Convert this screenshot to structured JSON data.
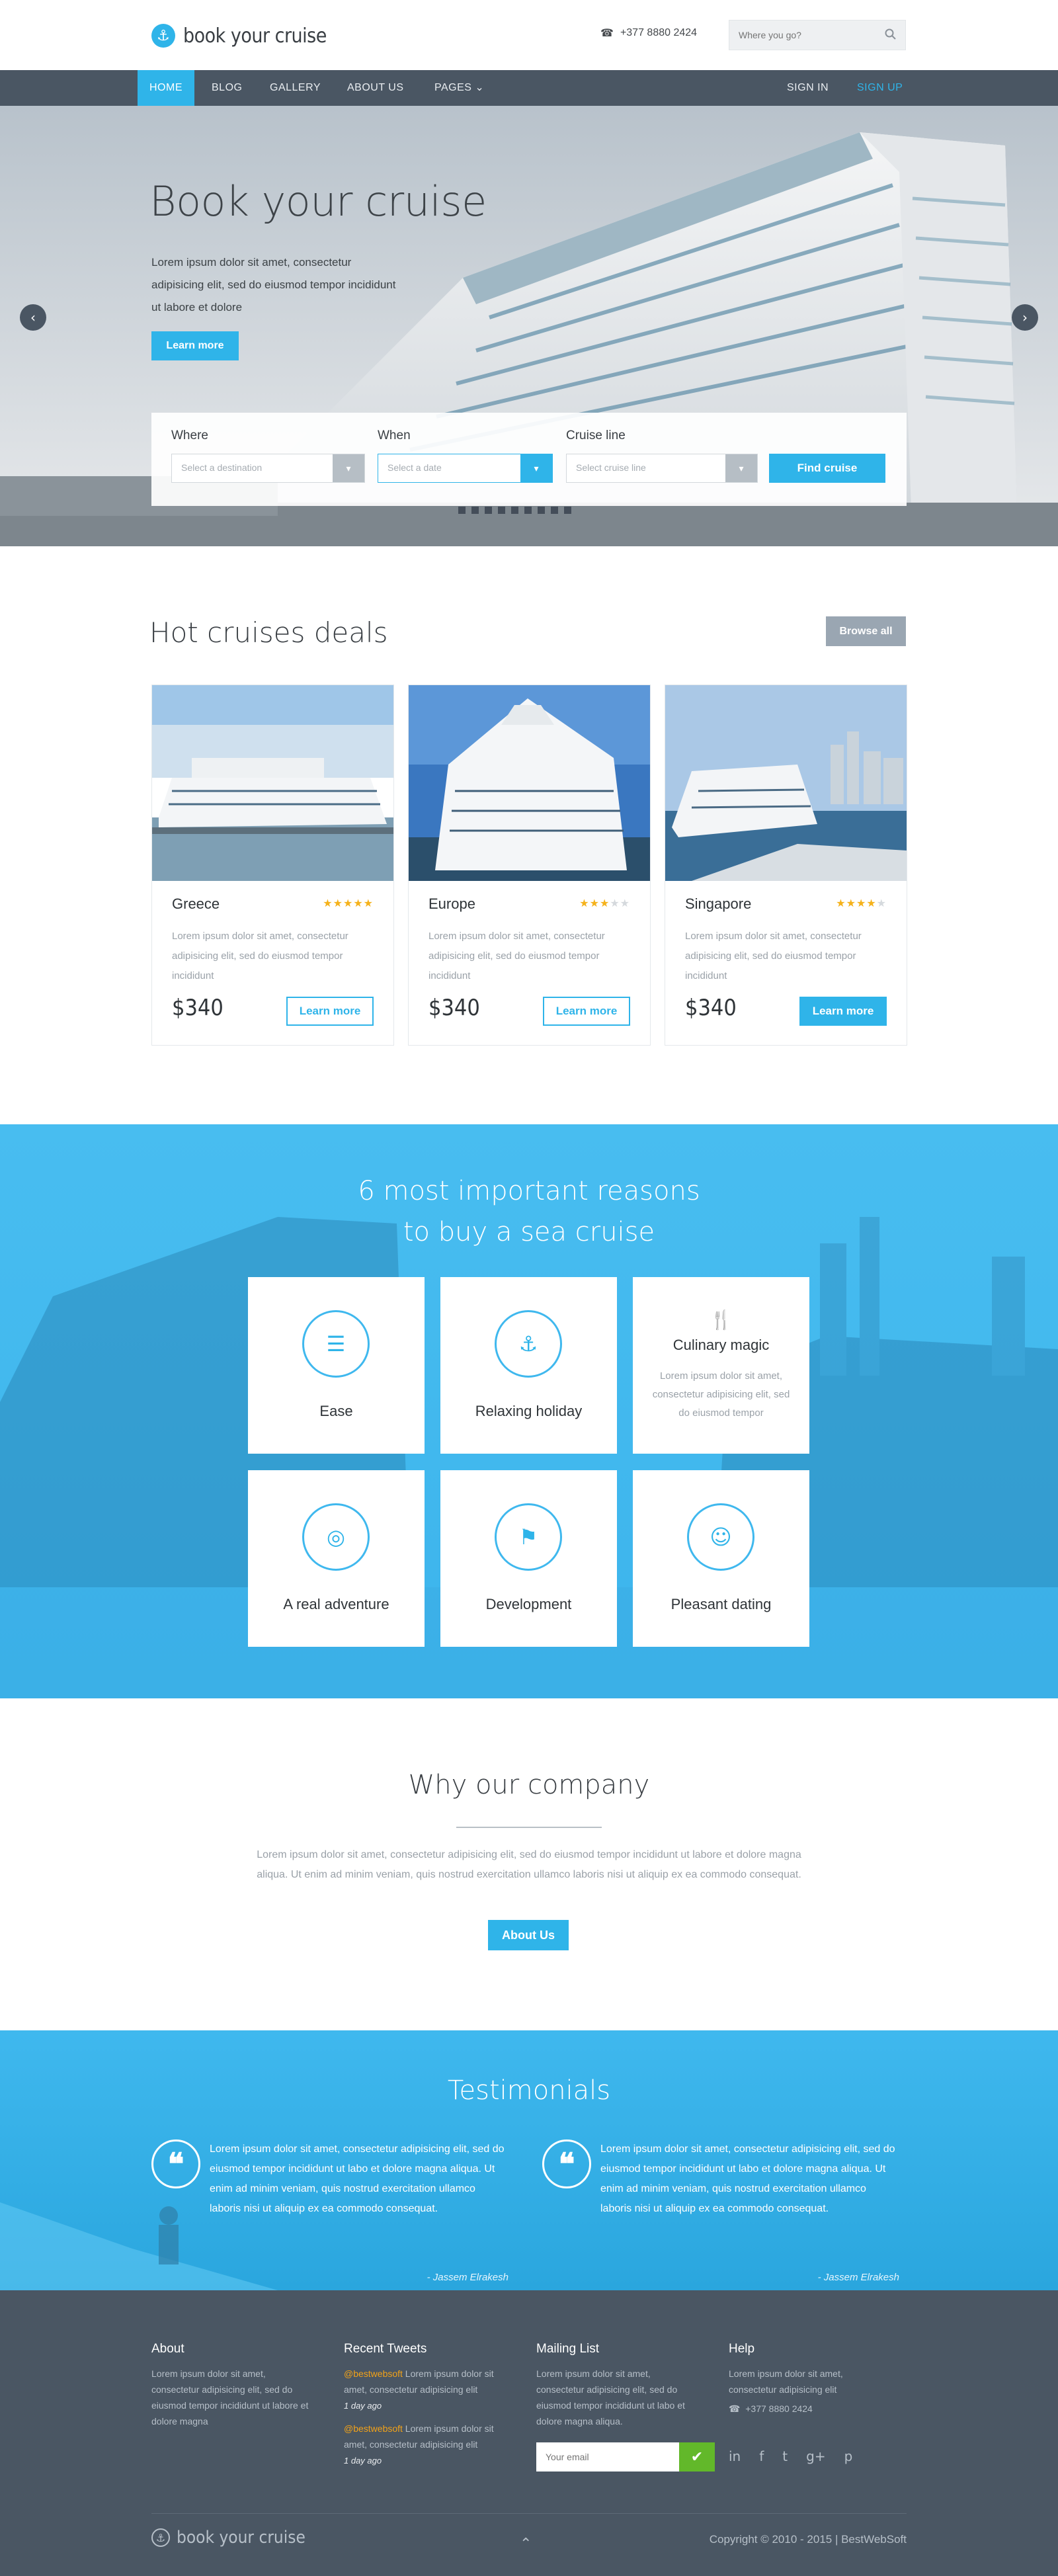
{
  "brand": {
    "name": "book your cruise",
    "icon": "anchor-icon",
    "accent": "#2fb4e9",
    "nav_bg": "#4a5663"
  },
  "header": {
    "phone": "+377  8880  2424",
    "search_placeholder": "Where you go?"
  },
  "nav": {
    "items": [
      "Home",
      "Blog",
      "Gallery",
      "About us",
      "Pages ⌄"
    ],
    "signin": "Sign in",
    "signup": "Sign up"
  },
  "hero": {
    "title": "Book your cruise",
    "lead": "Lorem ipsum dolor sit amet, consectetur adipisicing elit, sed do eiusmod tempor incididunt ut labore et dolore",
    "learn": "Learn more",
    "form": {
      "where_label": "Where",
      "where_placeholder": "Select a destination",
      "when_label": "When",
      "when_placeholder": "Select a date",
      "line_label": "Cruise line",
      "line_placeholder": "Select cruise line",
      "find": "Find cruise"
    },
    "slides": 9
  },
  "deals": {
    "title": "Hot cruises deals",
    "browse": "Browse all",
    "cards": [
      {
        "name": "Greece",
        "rating": 5,
        "desc": "Lorem ipsum dolor sit amet, consectetur adipisicing elit, sed do eiusmod tempor incididunt",
        "price": "$340",
        "button": "Learn more"
      },
      {
        "name": "Europe",
        "rating": 3,
        "desc": "Lorem ipsum dolor sit amet, consectetur adipisicing elit, sed do eiusmod tempor incididunt",
        "price": "$340",
        "button": "Learn more"
      },
      {
        "name": "Singapore",
        "rating": 4,
        "desc": "Lorem ipsum dolor sit amet, consectetur adipisicing elit, sed do eiusmod tempor incididunt",
        "price": "$340",
        "button": "Learn more"
      }
    ]
  },
  "reasons": {
    "title_line1": "6 most important reasons",
    "title_line2": "to buy a sea cruise",
    "items": [
      {
        "title": "Ease",
        "icon": "list-icon"
      },
      {
        "title": "Relaxing holiday",
        "icon": "anchor-icon"
      },
      {
        "title": "Culinary magic",
        "icon": "cutlery-icon",
        "desc": "Lorem ipsum dolor sit amet, consectetur adipisicing elit, sed do eiusmod tempor"
      },
      {
        "title": "A real adventure",
        "icon": "lifebuoy-icon"
      },
      {
        "title": "Development",
        "icon": "flag-icon"
      },
      {
        "title": "Pleasant dating",
        "icon": "smile-icon"
      }
    ]
  },
  "why": {
    "title": "Why our company",
    "text": "Lorem ipsum dolor sit amet, consectetur adipisicing elit, sed do eiusmod tempor incididunt ut labore et dolore magna aliqua. Ut enim ad minim veniam, quis nostrud exercitation ullamco laboris nisi ut aliquip ex ea commodo consequat.",
    "button": "About Us"
  },
  "testimonials": {
    "title": "Testimonials",
    "items": [
      {
        "text": "Lorem ipsum dolor sit amet, consectetur adipisicing elit, sed do eiusmod tempor incididunt ut labo et dolore magna aliqua. Ut enim ad minim veniam, quis nostrud exercitation ullamco laboris nisi ut aliquip ex ea commodo consequat.",
        "author": "- Jassem Elrakesh"
      },
      {
        "text": "Lorem ipsum dolor sit amet, consectetur adipisicing elit, sed do eiusmod tempor incididunt ut labo et dolore magna aliqua. Ut enim ad minim veniam, quis nostrud exercitation ullamco laboris nisi ut aliquip ex ea commodo consequat.",
        "author": "- Jassem Elrakesh"
      }
    ]
  },
  "footer": {
    "about_title": "About",
    "about_text": "Lorem ipsum dolor sit amet, consectetur adipisicing elit, sed do eiusmod tempor incididunt ut labore et dolore magna",
    "tweets_title": "Recent Tweets",
    "tweets": [
      {
        "handle": "@bestwebsoft",
        "text": " Lorem ipsum dolor sit amet, consectetur adipisicing elit",
        "ago": "1 day ago"
      },
      {
        "handle": "@bestwebsoft",
        "text": " Lorem ipsum dolor sit amet, consectetur adipisicing elit",
        "ago": "1 day ago"
      }
    ],
    "mailing_title": "Mailing List",
    "mailing_text": "Lorem ipsum dolor sit amet, consectetur adipisicing elit, sed do eiusmod tempor incididunt ut labo et dolore magna aliqua.",
    "email_placeholder": "Your email",
    "help_title": "Help",
    "help_text": "Lorem ipsum dolor sit amet, consectetur adipisicing elit",
    "phone": "+377  8880  2424",
    "social": [
      "in",
      "f",
      "t",
      "g+",
      "p"
    ],
    "copyright": "Copyright © 2010 - 2015 | BestWebSoft"
  }
}
